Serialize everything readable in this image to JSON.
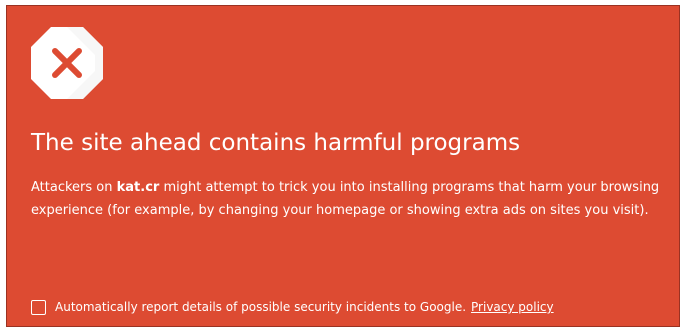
{
  "colors": {
    "background": "#dd4b32",
    "text": "#ffffff",
    "icon_cross": "#dd4b32"
  },
  "icon": {
    "name": "stop-octagon-x-icon"
  },
  "title": "The site ahead contains harmful programs",
  "message": {
    "before": "Attackers on ",
    "site": "kat.cr",
    "after": " might attempt to trick you into installing programs that harm your browsing experience (for example, by changing your homepage or showing extra ads on sites you visit)."
  },
  "report": {
    "checked": false,
    "label": "Automatically report details of possible security incidents to Google.",
    "link_label": "Privacy policy"
  }
}
